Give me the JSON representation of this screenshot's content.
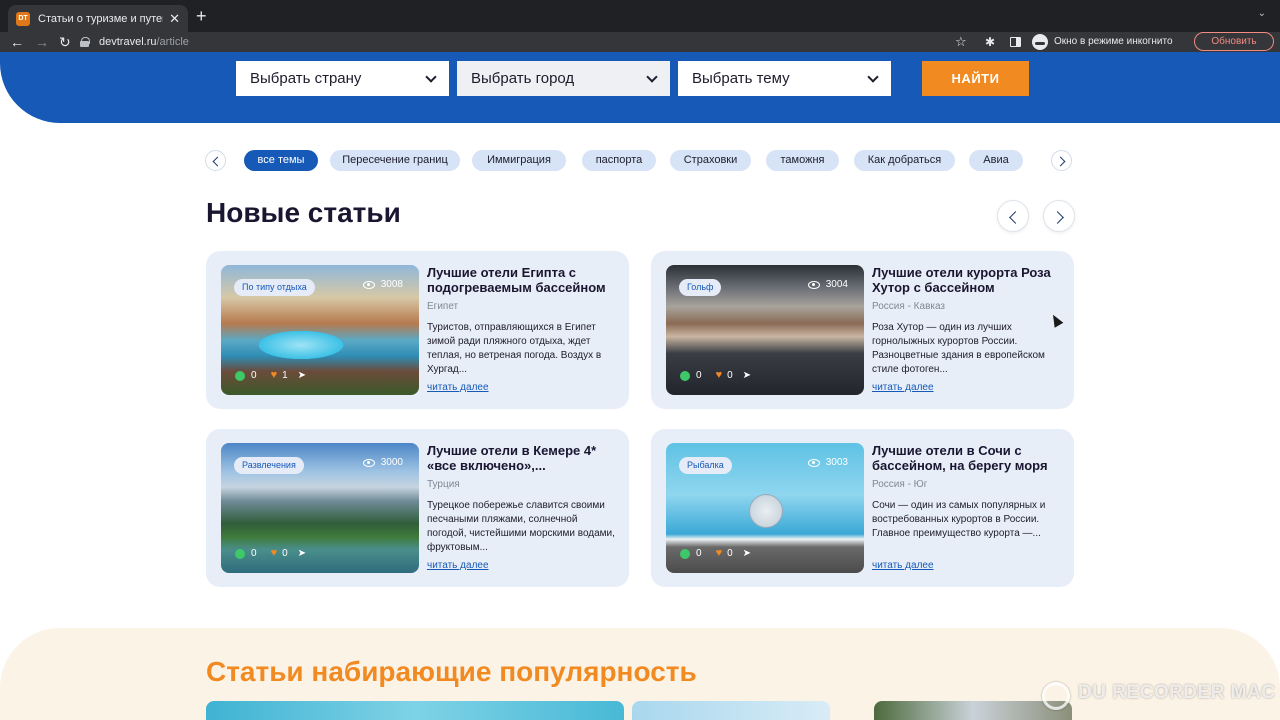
{
  "browser": {
    "tab_title": "Статьи о туризме и путешест",
    "tab_favicon_text": "DT",
    "url_host": "devtravel.ru",
    "url_path": "/article",
    "incognito_label": "Окно в режиме инкогнито",
    "update_label": "Обновить"
  },
  "search": {
    "country_label": "Выбрать страну",
    "city_label": "Выбрать город",
    "topic_label": "Выбрать тему",
    "find_label": "НАЙТИ"
  },
  "topics": [
    "все темы",
    "Пересечение границ",
    "Иммиграция",
    "паспорта",
    "Страховки",
    "таможня",
    "Как добраться",
    "Авиа"
  ],
  "new_articles": {
    "title": "Новые статьи",
    "read_more": "читать далее",
    "cards": [
      {
        "badge": "По типу отдыха",
        "views": "3008",
        "comments": "0",
        "likes": "1",
        "title": "Лучшие отели Египта с подогреваемым бассейном",
        "subtitle": "Египет",
        "text": "Туристов, отправляющихся в Египет зимой ради пляжного отдыха, ждет теплая, но ветреная погода. Воздух в Хургад..."
      },
      {
        "badge": "Гольф",
        "views": "3004",
        "comments": "0",
        "likes": "0",
        "title": "Лучшие отели курорта Роза Хутор с бассейном",
        "subtitle": "Россия - Кавказ",
        "text": "Роза Хутор — один из лучших горнолыжных курортов России. Разноцветные здания в европейском стиле фотоген..."
      },
      {
        "badge": "Развлечения",
        "views": "3000",
        "comments": "0",
        "likes": "0",
        "title": "Лучшие отели в Кемере 4* «все включено»,...",
        "subtitle": "Турция",
        "text": "Турецкое побережье славится своими песчаными пляжами, солнечной погодой, чистейшими морскими водами, фруктовым..."
      },
      {
        "badge": "Рыбалка",
        "views": "3003",
        "comments": "0",
        "likes": "0",
        "title": "Лучшие отели в Сочи с бассейном, на берегу моря",
        "subtitle": "Россия - Юг",
        "text": "Сочи — один из самых популярных и востребованных курортов в России. Главное преимущество курорта —..."
      }
    ]
  },
  "popular": {
    "title": "Статьи набирающие популярность"
  },
  "watermark": "DU RECORDER MAC"
}
